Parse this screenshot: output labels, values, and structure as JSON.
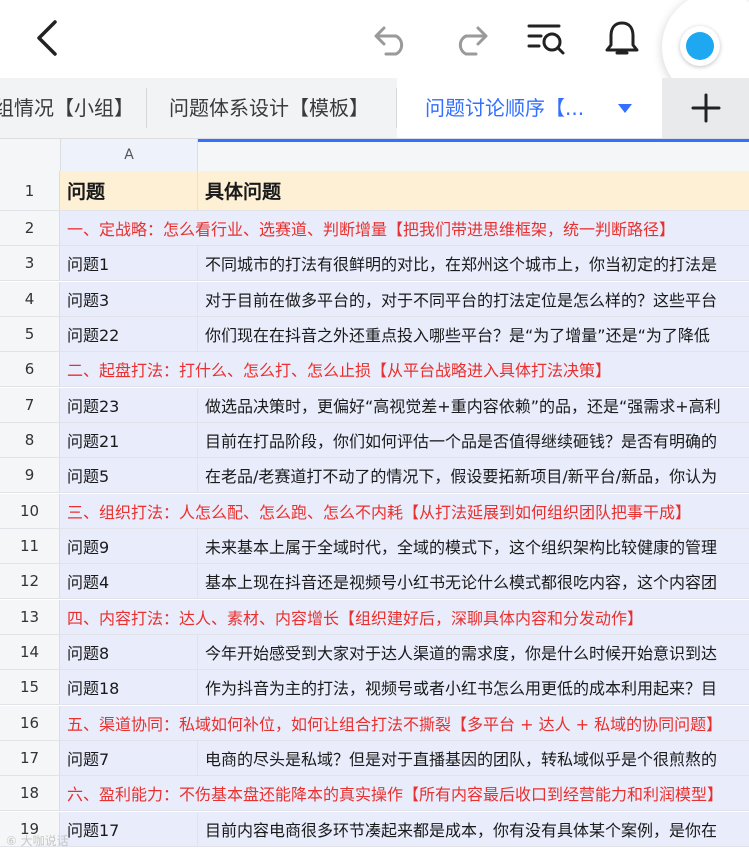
{
  "toolbar": {
    "icons": [
      "back-icon",
      "undo-icon",
      "redo-icon",
      "search-list-icon",
      "bell-icon",
      "avatar"
    ],
    "accent": "#3370ff"
  },
  "tabs": {
    "items": [
      {
        "label": "组情况【小组】"
      },
      {
        "label": "问题体系设计【模板】"
      },
      {
        "label": "问题讨论顺序【..."
      }
    ],
    "add_label": "+"
  },
  "sheet": {
    "col_a": "A",
    "header": {
      "num": "1",
      "a": "问题",
      "b": "具体问题"
    },
    "rows": [
      {
        "num": "2",
        "section": "一、定战略：怎么看行业、选赛道、判断增量【把我们带进思维框架，统一判断路径】"
      },
      {
        "num": "3",
        "a": "问题1",
        "b": "不同城市的打法有很鲜明的对比，在郑州这个城市上，你当初定的打法是"
      },
      {
        "num": "4",
        "a": "问题3",
        "b": "对于目前在做多平台的，对于不同平台的打法定位是怎么样的？这些平台"
      },
      {
        "num": "5",
        "a": "问题22",
        "b": "你们现在在抖音之外还重点投入哪些平台？是“为了增量”还是“为了降低"
      },
      {
        "num": "6",
        "section": "二、起盘打法：打什么、怎么打、怎么止损【从平台战略进入具体打法决策】"
      },
      {
        "num": "7",
        "a": "问题23",
        "b": "做选品决策时，更偏好“高视觉差+重内容依赖”的品，还是“强需求+高利"
      },
      {
        "num": "8",
        "a": "问题21",
        "b": "目前在打品阶段，你们如何评估一个品是否值得继续砸钱？是否有明确的"
      },
      {
        "num": "9",
        "a": "问题5",
        "b": "在老品/老赛道打不动了的情况下，假设要拓新项目/新平台/新品，你认为"
      },
      {
        "num": "10",
        "section": "三、组织打法：人怎么配、怎么跑、怎么不内耗【从打法延展到如何组织团队把事干成】"
      },
      {
        "num": "11",
        "a": "问题9",
        "b": "未来基本上属于全域时代，全域的模式下，这个组织架构比较健康的管理"
      },
      {
        "num": "12",
        "a": "问题4",
        "b": "基本上现在抖音还是视频号小红书无论什么模式都很吃内容，这个内容团"
      },
      {
        "num": "13",
        "section": "四、内容打法：达人、素材、内容增长【组织建好后，深聊具体内容和分发动作】"
      },
      {
        "num": "14",
        "a": "问题8",
        "b": "今年开始感受到大家对于达人渠道的需求度，你是什么时候开始意识到达"
      },
      {
        "num": "15",
        "a": "问题18",
        "b": "作为抖音为主的打法，视频号或者小红书怎么用更低的成本利用起来？目"
      },
      {
        "num": "16",
        "section": "五、渠道协同：私域如何补位，如何让组合打法不撕裂【多平台 + 达人 + 私域的协同问题】"
      },
      {
        "num": "17",
        "a": "问题7",
        "b": "电商的尽头是私域？但是对于直播基因的团队，转私域似乎是个很煎熬的"
      },
      {
        "num": "18",
        "section": "六、盈利能力：不伤基本盘还能降本的真实操作【所有内容最后收口到经营能力和利润模型】"
      },
      {
        "num": "19",
        "a": "问题17",
        "b": "目前内容电商很多环节凑起来都是成本，你有没有具体某个案例，是你在"
      }
    ]
  },
  "watermark": "⑥ 大咖说话"
}
